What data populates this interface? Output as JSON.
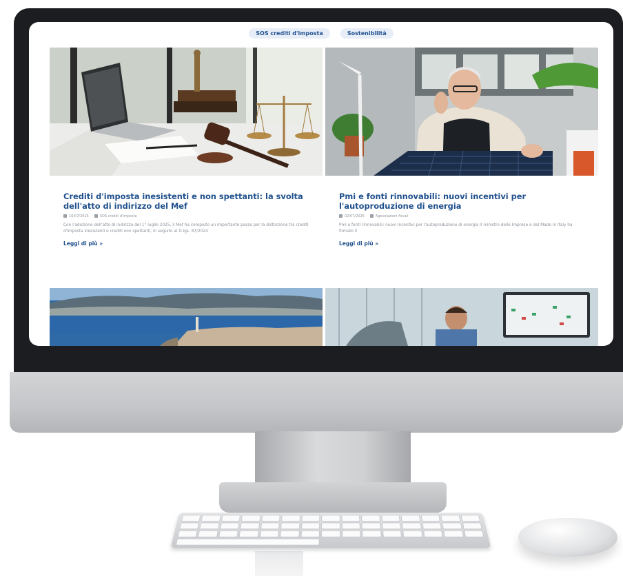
{
  "tags": [
    "SOS crediti d'imposta",
    "Sostenibilità"
  ],
  "articles": [
    {
      "title": "Crediti d'imposta inesistenti e non spettanti: la svolta dell'atto di indirizzo del Mef",
      "date": "10/07/2025",
      "category": "SOS crediti d'imposta",
      "excerpt": "Con l'adozione dell'atto di indirizzo del 1° luglio 2025, il Mef ha compiuto un importante passo per la distinzione tra crediti d'imposta inesistenti e crediti non spettanti, in seguito al D.lgs. 87/2024",
      "more": "Leggi di più »",
      "image": "legal-desk-image"
    },
    {
      "title": "Pmi e fonti rinnovabili: nuovi incentivi per l'autoproduzione di energia",
      "date": "02/07/2025",
      "category": "Agevolazioni fiscali",
      "excerpt": "Pmi e fonti rinnovabili: nuovi incentivi per l'autoproduzione di energia Il ministro delle Imprese e del Made in Italy ha firmato il",
      "more": "Leggi di più »",
      "image": "businessman-solar-image"
    }
  ],
  "colors": {
    "accent": "#1e4f8c",
    "tag_bg": "#e8eef8",
    "bezel": "#1c1d20"
  }
}
